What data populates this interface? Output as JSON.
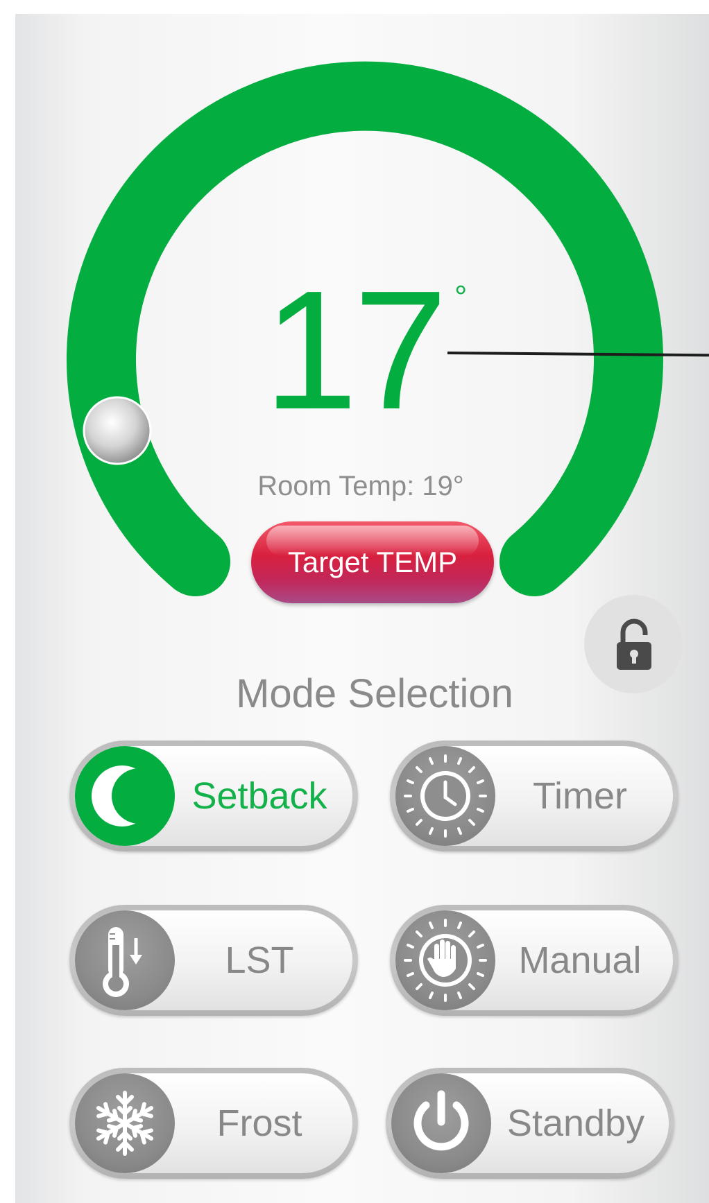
{
  "thermostat": {
    "setpoint": "17",
    "degree_symbol": "°",
    "room_temp_text": "Room Temp: 19°",
    "target_button_label": "Target TEMP",
    "accent_color": "#04ad3f",
    "target_button_color": "#d8203e",
    "dial_level": 0.28,
    "lock_state": "unlocked"
  },
  "modes": {
    "title": "Mode Selection",
    "active": "Setback",
    "items": [
      {
        "label": "Setback",
        "icon": "moon-icon"
      },
      {
        "label": "Timer",
        "icon": "clock-icon"
      },
      {
        "label": "LST",
        "icon": "thermometer-down-icon"
      },
      {
        "label": "Manual",
        "icon": "hand-icon"
      },
      {
        "label": "Frost",
        "icon": "snowflake-icon"
      },
      {
        "label": "Standby",
        "icon": "power-icon"
      }
    ]
  }
}
